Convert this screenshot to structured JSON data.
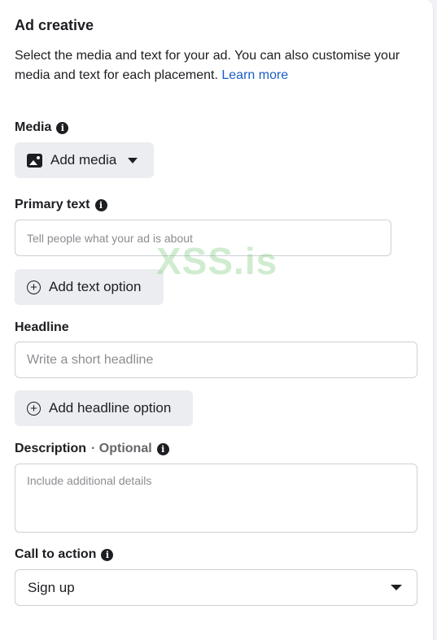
{
  "section": {
    "title": "Ad creative",
    "description": "Select the media and text for your ad. You can also customise your media and text for each placement.",
    "learn_more": "Learn more"
  },
  "media": {
    "label": "Media",
    "button_label": "Add media",
    "icon": "image-icon"
  },
  "primary_text": {
    "label": "Primary text",
    "placeholder": "Tell people what your ad is about",
    "add_option_label": "Add text option"
  },
  "headline": {
    "label": "Headline",
    "placeholder": "Write a short headline",
    "add_option_label": "Add headline option"
  },
  "description_field": {
    "label": "Description",
    "optional": "· Optional",
    "placeholder": "Include additional details"
  },
  "call_to_action": {
    "label": "Call to action",
    "selected": "Sign up"
  },
  "watermark": "XSS.is",
  "colors": {
    "link": "#1a5fc4",
    "button_bg": "#ebedf0",
    "border": "#ccd0d5"
  }
}
